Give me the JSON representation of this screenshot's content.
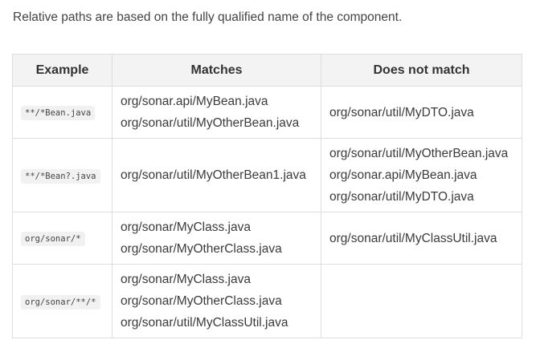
{
  "intro_text": "Relative paths are based on the fully qualified name of the component.",
  "table": {
    "headers": {
      "example": "Example",
      "matches": "Matches",
      "does_not_match": "Does not match"
    },
    "rows": [
      {
        "example": "**/*Bean.java",
        "matches": [
          "org/sonar.api/MyBean.java",
          "org/sonar/util/MyOtherBean.java"
        ],
        "does_not_match": [
          "org/sonar/util/MyDTO.java"
        ]
      },
      {
        "example": "**/*Bean?.java",
        "matches": [
          "org/sonar/util/MyOtherBean1.java"
        ],
        "does_not_match": [
          "org/sonar/util/MyOtherBean.java",
          "org/sonar.api/MyBean.java",
          "org/sonar/util/MyDTO.java"
        ]
      },
      {
        "example": "org/sonar/*",
        "matches": [
          "org/sonar/MyClass.java",
          "org/sonar/MyOtherClass.java"
        ],
        "does_not_match": [
          "org/sonar/util/MyClassUtil.java"
        ]
      },
      {
        "example": "org/sonar/**/*",
        "matches": [
          "org/sonar/MyClass.java",
          "org/sonar/MyOtherClass.java",
          "org/sonar/util/MyClassUtil.java"
        ],
        "does_not_match": []
      }
    ]
  }
}
